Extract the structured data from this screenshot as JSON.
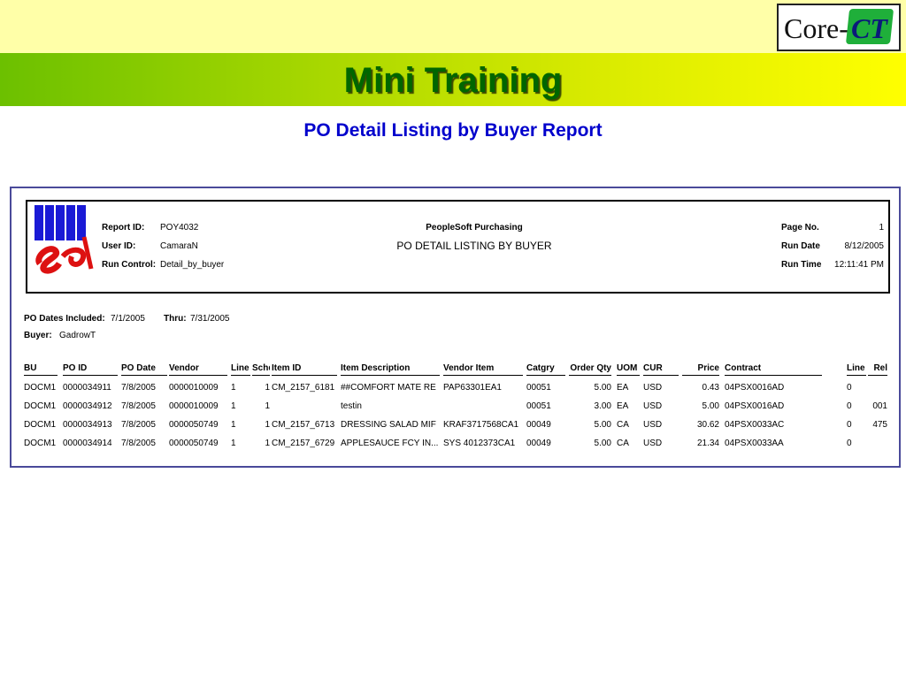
{
  "slide": {
    "title": "Mini Training",
    "subtitle": "PO Detail Listing by Buyer Report",
    "logo": {
      "prefix": "Core-",
      "accent": "CT"
    }
  },
  "report": {
    "header": {
      "report_id_label": "Report ID:",
      "report_id": "POY4032",
      "user_id_label": "User ID:",
      "user_id": "CamaraN",
      "run_control_label": "Run Control:",
      "run_control": "Detail_by_buyer",
      "app_name": "PeopleSoft Purchasing",
      "report_title": "PO DETAIL LISTING BY BUYER",
      "page_no_label": "Page No.",
      "page_no": "1",
      "run_date_label": "Run Date",
      "run_date": "8/12/2005",
      "run_time_label": "Run Time",
      "run_time": "12:11:41 PM"
    },
    "criteria": {
      "dates_label": "PO Dates Included:",
      "date_from": "7/1/2005",
      "thru_label": "Thru:",
      "date_to": "7/31/2005",
      "buyer_label": "Buyer:",
      "buyer": "GadrowT"
    },
    "columns": [
      "BU",
      "PO ID",
      "PO Date",
      "Vendor",
      "Line",
      "Schd",
      "Item ID",
      "Item Description",
      "Vendor Item",
      "Catgry",
      "Order Qty",
      "UOM",
      "CUR",
      "Price",
      "Contract",
      "Line",
      "Rel"
    ],
    "rows": [
      [
        "DOCM1",
        "0000034911",
        "7/8/2005",
        "0000010009",
        "1",
        "1",
        "CM_2157_6181",
        "##COMFORT MATE RE",
        "PAP63301EA1",
        "00051",
        "5.00",
        "EA",
        "USD",
        "0.43",
        "04PSX0016AD",
        "0",
        ""
      ],
      [
        "DOCM1",
        "0000034912",
        "7/8/2005",
        "0000010009",
        "1",
        "1",
        "",
        "testin",
        "",
        "00051",
        "3.00",
        "EA",
        "USD",
        "5.00",
        "04PSX0016AD",
        "0",
        "001"
      ],
      [
        "DOCM1",
        "0000034913",
        "7/8/2005",
        "0000050749",
        "1",
        "1",
        "CM_2157_6713",
        "DRESSING SALAD MIF",
        "KRAF3717568CA1",
        "00049",
        "5.00",
        "CA",
        "USD",
        "30.62",
        "04PSX0033AC",
        "0",
        "475"
      ],
      [
        "DOCM1",
        "0000034914",
        "7/8/2005",
        "0000050749",
        "1",
        "1",
        "CM_2157_6729",
        "APPLESAUCE FCY IN...",
        "SYS 4012373CA1",
        "00049",
        "5.00",
        "CA",
        "USD",
        "21.34",
        "04PSX0033AA",
        "0",
        ""
      ]
    ]
  },
  "colors": {
    "title_green": "#006600",
    "subtitle_blue": "#0000cc",
    "frame_border": "#4a4a9a"
  },
  "icons": [
    "peoplesoft-logo",
    "core-ct-logo"
  ]
}
